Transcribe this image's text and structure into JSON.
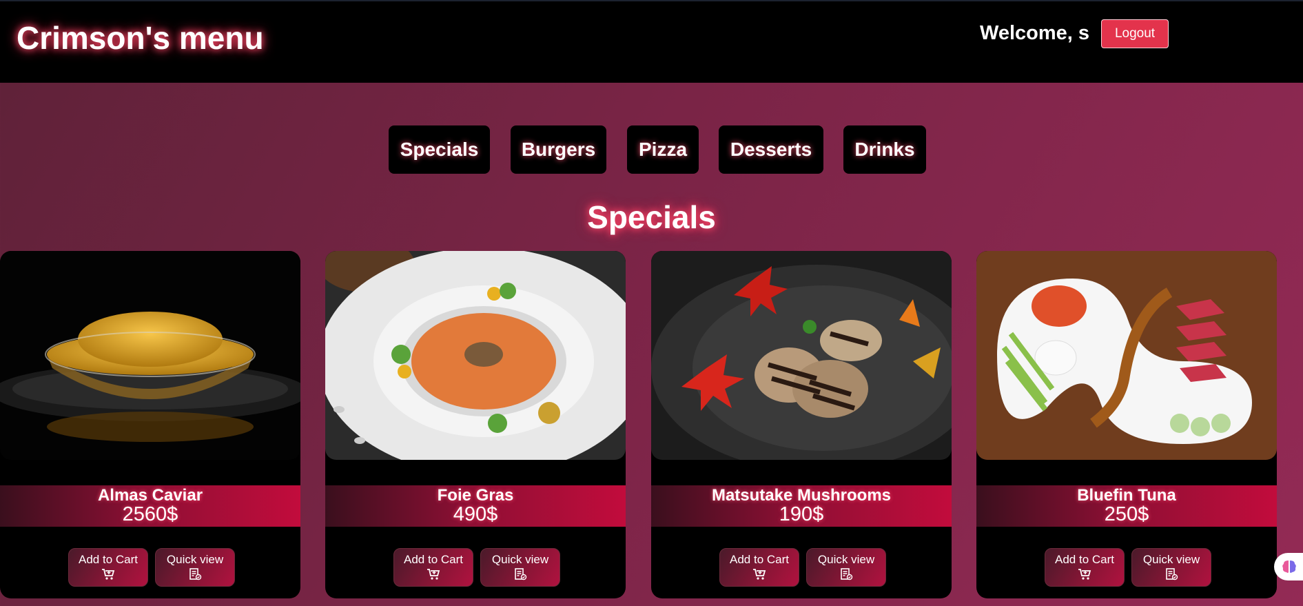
{
  "header": {
    "brand": "Crimson's menu",
    "welcome": "Welcome, s",
    "logout_label": "Logout"
  },
  "nav": {
    "items": [
      "Specials",
      "Burgers",
      "Pizza",
      "Desserts",
      "Drinks"
    ]
  },
  "section_title": "Specials",
  "cards": [
    {
      "name": "Almas Caviar",
      "price": "2560$",
      "add_label": "Add to Cart",
      "quick_label": "Quick view"
    },
    {
      "name": "Foie Gras",
      "price": "490$",
      "add_label": "Add to Cart",
      "quick_label": "Quick view"
    },
    {
      "name": "Matsutake Mushrooms",
      "price": "190$",
      "add_label": "Add to Cart",
      "quick_label": "Quick view"
    },
    {
      "name": "Bluefin Tuna",
      "price": "250$",
      "add_label": "Add to Cart",
      "quick_label": "Quick view"
    }
  ],
  "icons": {
    "add_to_cart": "cart-plus-icon",
    "quick_view": "receipt-check-icon",
    "assistant": "brain-icon"
  },
  "colors": {
    "accent": "#e3334c",
    "band": "#c20c3c",
    "header_bg": "#000000"
  }
}
